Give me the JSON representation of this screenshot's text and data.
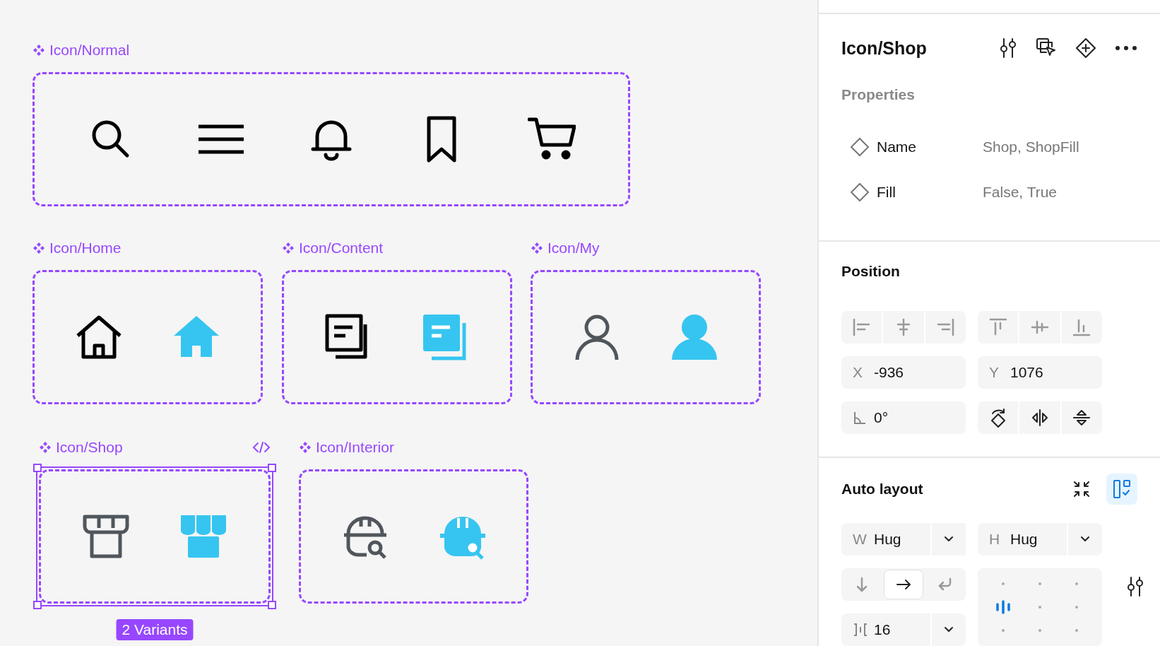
{
  "canvas": {
    "component_sets": [
      {
        "kind": "normal",
        "label": "Icon/Normal",
        "selected": false
      },
      {
        "kind": "home",
        "label": "Icon/Home",
        "selected": false
      },
      {
        "kind": "content",
        "label": "Icon/Content",
        "selected": false
      },
      {
        "kind": "my",
        "label": "Icon/My",
        "selected": false
      },
      {
        "kind": "shop",
        "label": "Icon/Shop",
        "selected": true
      },
      {
        "kind": "interior",
        "label": "Icon/Interior",
        "selected": false
      }
    ],
    "variant_badge": "2 Variants"
  },
  "inspector": {
    "title": "Icon/Shop",
    "properties": {
      "heading": "Properties",
      "items": [
        {
          "name": "Name",
          "value": "Shop, ShopFill"
        },
        {
          "name": "Fill",
          "value": "False, True"
        }
      ]
    },
    "position": {
      "heading": "Position",
      "x": {
        "label": "X",
        "value": "-936"
      },
      "y": {
        "label": "Y",
        "value": "1076"
      },
      "rotation": "0°"
    },
    "auto_layout": {
      "heading": "Auto layout",
      "width": {
        "label": "W",
        "value": "Hug"
      },
      "height": {
        "label": "H",
        "value": "Hug"
      },
      "directions": [
        {
          "kind": "down",
          "selected": false
        },
        {
          "kind": "right",
          "selected": true
        },
        {
          "kind": "wrap",
          "selected": false
        }
      ],
      "gap": "16",
      "alignment": [
        {
          "selected": false
        },
        {
          "selected": false
        },
        {
          "selected": false
        },
        {
          "selected": true
        },
        {
          "selected": false
        },
        {
          "selected": false
        },
        {
          "selected": false
        },
        {
          "selected": false
        },
        {
          "selected": false
        }
      ]
    }
  }
}
